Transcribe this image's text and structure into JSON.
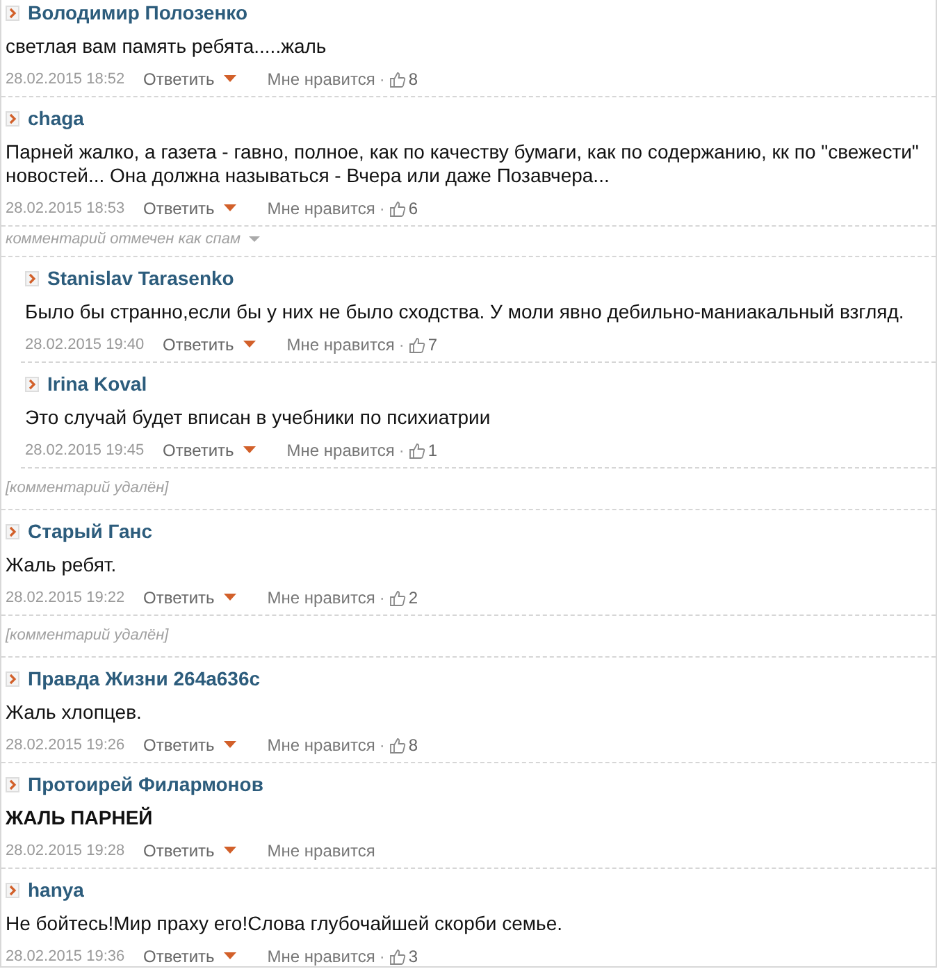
{
  "comments": [
    {
      "kind": "comment",
      "author": "Володимир Полозенко",
      "text": "светлая вам память ребята.....жаль",
      "bold": false,
      "date": "28.02.2015 18:52",
      "reply": "Ответить",
      "like": "Мне нравится",
      "like_separator": "·",
      "likes": "8"
    },
    {
      "kind": "comment",
      "author": "chaga",
      "text": "Парней жалко, а газета - гавно, полное, как по качеству бумаги, как по содержанию, кк по \"свежести\" новостей... Она должна называться - Вчера или даже Позавчера...",
      "bold": false,
      "date": "28.02.2015 18:53",
      "reply": "Ответить",
      "like": "Мне нравится",
      "like_separator": "·",
      "likes": "6"
    },
    {
      "kind": "spam",
      "text": "комментарий отмечен как спам",
      "children": [
        {
          "kind": "comment",
          "author": "Stanislav Tarasenko",
          "text": "Было бы странно,если бы у них не было сходства. У моли явно дебильно-маниакальный взгляд.",
          "bold": false,
          "date": "28.02.2015 19:40",
          "reply": "Ответить",
          "like": "Мне нравится",
          "like_separator": "·",
          "likes": "7"
        },
        {
          "kind": "comment",
          "author": "Irina Koval",
          "text": "Это случай будет вписан в учебники по психиатрии",
          "bold": false,
          "date": "28.02.2015 19:45",
          "reply": "Ответить",
          "like": "Мне нравится",
          "like_separator": "·",
          "likes": "1"
        }
      ]
    },
    {
      "kind": "deleted",
      "text": "[комментарий удалён]"
    },
    {
      "kind": "comment",
      "author": "Старый Ганс",
      "text": "Жаль ребят.",
      "bold": false,
      "date": "28.02.2015 19:22",
      "reply": "Ответить",
      "like": "Мне нравится",
      "like_separator": "·",
      "likes": "2"
    },
    {
      "kind": "deleted",
      "text": "[комментарий удалён]"
    },
    {
      "kind": "comment",
      "author": "Правда Жизни 264a636c",
      "text": "Жаль хлопцев.",
      "bold": false,
      "date": "28.02.2015 19:26",
      "reply": "Ответить",
      "like": "Мне нравится",
      "like_separator": "·",
      "likes": "8"
    },
    {
      "kind": "comment",
      "author": "Протоирей Филармонов",
      "text": "ЖАЛЬ ПАРНЕЙ",
      "bold": true,
      "date": "28.02.2015 19:28",
      "reply": "Ответить",
      "like": "Мне нравится"
    },
    {
      "kind": "comment",
      "author": "hanya",
      "text": "Не бойтесь!Мир праху его!Слова глубочайшей скорби семье.",
      "bold": false,
      "date": "28.02.2015 19:36",
      "reply": "Ответить",
      "like": "Мне нравится",
      "like_separator": "·",
      "likes": "3"
    }
  ]
}
